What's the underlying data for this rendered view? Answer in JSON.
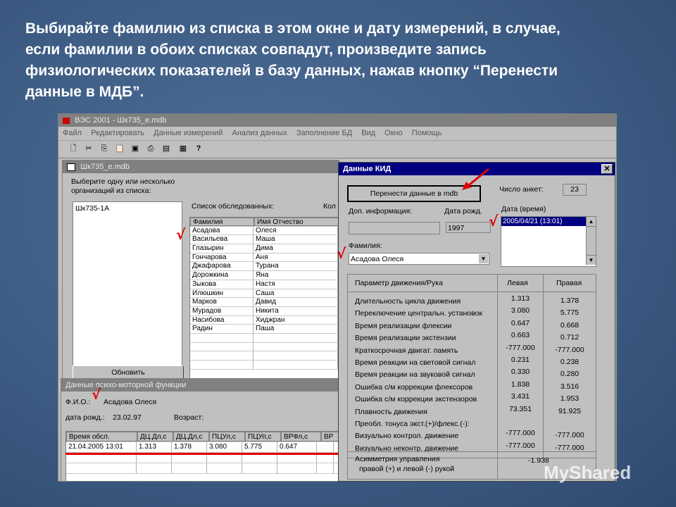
{
  "slide": {
    "title": "Выбирайте фамилию из списка в этом окне и дату измерений,  в случае,\nесли фамилии в обоих списках совпадут, произведите запись\nфизиологических показателей в базу данных, нажав кнопку “Перенести\nданные в МДБ”."
  },
  "app": {
    "title": "ВЭС 2001 - Шк735_е.mdb",
    "menu": [
      "Файл",
      "Редактировать",
      "Данные измерений",
      "Анализ данных",
      "Заполнение БД",
      "Вид",
      "Окно",
      "Помощь"
    ]
  },
  "left_window": {
    "title": "Шк735_е.mdb",
    "prompt": "Выберите одну или несколько организаций из списка:",
    "org_list": [
      "Шк735-1А"
    ],
    "people_label": "Список обследованных:",
    "col_label_cut": "Кол",
    "columns": [
      "Фамилия",
      "Имя Отчество"
    ],
    "rows": [
      [
        "Асадова",
        "Олеся"
      ],
      [
        "Васильева",
        "Маша"
      ],
      [
        "Глазырин",
        "Дима"
      ],
      [
        "Гончарова",
        "Аня"
      ],
      [
        "Джафарова",
        "Турана"
      ],
      [
        "Дорожкина",
        "Яна"
      ],
      [
        "Зыкова",
        "Настя"
      ],
      [
        "Илюшкин",
        "Саша"
      ],
      [
        "Марков",
        "Давид"
      ],
      [
        "Мурадов",
        "Никита"
      ],
      [
        "Насибова",
        "Хиджран"
      ],
      [
        "Радин",
        "Паша"
      ]
    ],
    "refresh_button": "Обновить"
  },
  "psycho_window": {
    "title": "Данные психо-моторной функции",
    "fio_label": "Ф.И.О.:",
    "fio_value": "Асадова Олеся",
    "birth_label": "дата рожд.:",
    "birth_value": "23.02.97",
    "age_label": "Возраст:",
    "columns": [
      "Время обсл.",
      "ДЦ.Дл,с",
      "ДЦ.Дл,с",
      "ПЦУл,с",
      "ПЦУп,с",
      "ВРФл,с",
      "ВР"
    ],
    "rows": [
      [
        "21.04.2005 13:01",
        "1.313",
        "1.378",
        "3.080",
        "5.775",
        "0.647",
        ""
      ]
    ]
  },
  "kid_window": {
    "title": "Данные КИД",
    "transfer_button": "Перенести данные в mdb",
    "count_label": "Число анкет:",
    "count_value": "23",
    "extra_label": "Доп. информация:",
    "birth_label": "Дата рожд.",
    "birth_value": "1997",
    "date_label": "Дата (время)",
    "date_selected": "2005/04/21 (13:01)",
    "surname_label": "Фамилия:",
    "surname_value": "Асадова Олеся",
    "table_headers": [
      "Параметр движения/Рука",
      "Левая",
      "Правая"
    ],
    "params": [
      [
        "Длительность цикла движения",
        "1.313",
        "1.378"
      ],
      [
        "Переключение центральн. установок",
        "3.080",
        "5.775"
      ],
      [
        "Время реализации флексии",
        "0.647",
        "0.668"
      ],
      [
        "Время реализации экстензии",
        "0.663",
        "0.712"
      ],
      [
        "Краткосрочная двигат. память",
        "-777.000",
        "-777.000"
      ],
      [
        "Время реакции на световой сигнал",
        "0.231",
        "0.238"
      ],
      [
        "Время реакции на звуковой сигнал",
        "0.330",
        "0.280"
      ],
      [
        "Ошибка с/м коррекции флексоров",
        "1.838",
        "3.516"
      ],
      [
        "Ошибка с/м коррекции экстензоров",
        "3.431",
        "1.953"
      ],
      [
        "Плавность движения",
        "73.351",
        "91.925"
      ],
      [
        "Преобл. тонуса экст.(+)/флекс.(-):",
        "",
        ""
      ],
      [
        "Визуально контрол. движение",
        "-777.000",
        "-777.000"
      ],
      [
        "Визуально неконтр. движение",
        "-777.000",
        "-777.000"
      ]
    ],
    "asym_label_1": "Асимметрия управления",
    "asym_label_2": "правой (+) и левой (-) рукой",
    "asym_value": "-1.938"
  },
  "watermark": "MyShared",
  "colors": {
    "background": "#3f5e86",
    "accent_red": "#e00000",
    "active_title": "#000080"
  }
}
